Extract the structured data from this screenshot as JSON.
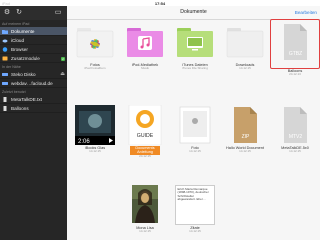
{
  "status": {
    "carrier": "iPad",
    "time": "17:54",
    "battery": ""
  },
  "sidebar": {
    "section_ipad": "Auf meinem iPad",
    "items_ipad": [
      {
        "label": "Dokumente",
        "icon": "folder-icon"
      },
      {
        "label": "iCloud",
        "icon": "cloud-icon"
      },
      {
        "label": "Browser",
        "icon": "globe-icon"
      },
      {
        "label": "Zusatzmodule",
        "icon": "puzzle-icon",
        "badge": "2"
      }
    ],
    "section_network": "In der Nähe",
    "items_network": [
      {
        "label": "Steko Disko",
        "icon": "wifi-icon"
      },
      {
        "label": "webdav…facloud.de",
        "icon": "server-icon"
      }
    ],
    "section_recent": "Zuletzt benutzt",
    "items_recent": [
      {
        "label": "MetaTalkDE.txt",
        "icon": "doc-icon"
      },
      {
        "label": "Balloons",
        "icon": "doc-icon"
      }
    ]
  },
  "main": {
    "title": "Dokumente",
    "edit_label": "Bearbeiten",
    "files": [
      {
        "name": "Fotos",
        "sub": "iPad Fotoalbum",
        "kind": "photos"
      },
      {
        "name": "iPod-Mediathek",
        "sub": "Musik",
        "kind": "music"
      },
      {
        "name": "iTunes Dateien",
        "sub": "iTunes File Sharing",
        "kind": "itunes"
      },
      {
        "name": "Downloads",
        "sub": "14.12.15",
        "kind": "downloads"
      },
      {
        "name": "Balloons",
        "sub": "24.12.13",
        "kind": "gtbz",
        "ext": "GTBZ"
      },
      {
        "name": "iBooks Glas",
        "sub": "14.12.15",
        "kind": "video",
        "duration": "2:06"
      },
      {
        "name": "Documents Anleitung",
        "sub": "24.12.15",
        "kind": "guide",
        "caption": "GUIDE"
      },
      {
        "name": "Foto",
        "sub": "14.12.15",
        "kind": "photo"
      },
      {
        "name": "Hallo World Document",
        "sub": "14.12.15",
        "kind": "zip",
        "ext": "ZIP"
      },
      {
        "name": "MetaTalkDE.5x0",
        "sub": "14.12.15",
        "kind": "mtv",
        "ext": "MTV2"
      },
      {
        "name": "Mona Lisa",
        "sub": "14.12.15",
        "kind": "painting"
      },
      {
        "name": "Zitate",
        "sub": "14.12.15",
        "kind": "text",
        "preview": "Erich Maria Remarque (1898-1970), deutscher Schriftsteller abgewandert. Eher…"
      }
    ]
  },
  "colors": {
    "accent": "#2a7de1",
    "sidebar_bg": "#262626",
    "selected": "#e04040"
  }
}
